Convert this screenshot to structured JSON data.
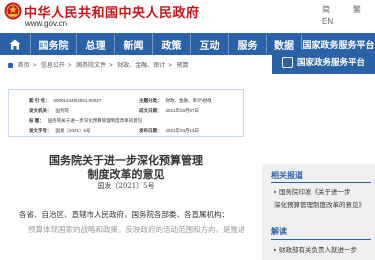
{
  "header": {
    "site_title": "中华人民共和国中央人民政府",
    "site_url": "www.gov.cn",
    "links": [
      "简",
      "繁",
      "EN"
    ]
  },
  "nav": {
    "home_icon": "home-icon",
    "items": [
      "国务院",
      "总理",
      "新闻",
      "政策",
      "互动",
      "服务",
      "数据",
      "国家政务服务平台"
    ]
  },
  "breadcrumb": {
    "items": [
      "首页",
      "信息公开",
      "国务院文件",
      "财政、金融、审计",
      "预算"
    ]
  },
  "info_box": {
    "index_label": "索  引  号：",
    "index_value": "000014349/2021-00027",
    "category_label": "主题分类：",
    "category_value": "财政、金融、审计\\财政",
    "issuer_label": "发文机关：",
    "issuer_value": "国务院",
    "date_label": "成文日期：",
    "date_value": "2021年03月07日",
    "title_label": "标      题：",
    "title_value": "国务院关于进一步深化预算管理制度改革的意见",
    "num_label": "发文字号：",
    "num_value": "国发〔2021〕5号",
    "pub_label": "发布日期：",
    "pub_value": "2021年04月13日"
  },
  "document": {
    "title_line1": "国务院关于进一步深化预算管理",
    "title_line2": "制度改革的意见",
    "doc_number": "国发〔2021〕5号",
    "salutation": "各省、自治区、直辖市人民政府，国务院各部委、各直属机构：",
    "paragraph_start": "预算体现国家的战略和政策，反映政府的活动范围和方向，是推进国家治理体系和治理能力"
  },
  "sidebar": {
    "ad_label": "国家政务服务平台",
    "related_title": "相关报道",
    "related_links": [
      "国务院印发《关于进一步",
      "深化预算管理制度改革的意见》"
    ],
    "interpret_title": "解读",
    "interpret_links": [
      "财政部有关负责人就进一步"
    ]
  },
  "colors": {
    "brand_red": "#c4161c",
    "nav_blue": "#2a62a8"
  }
}
